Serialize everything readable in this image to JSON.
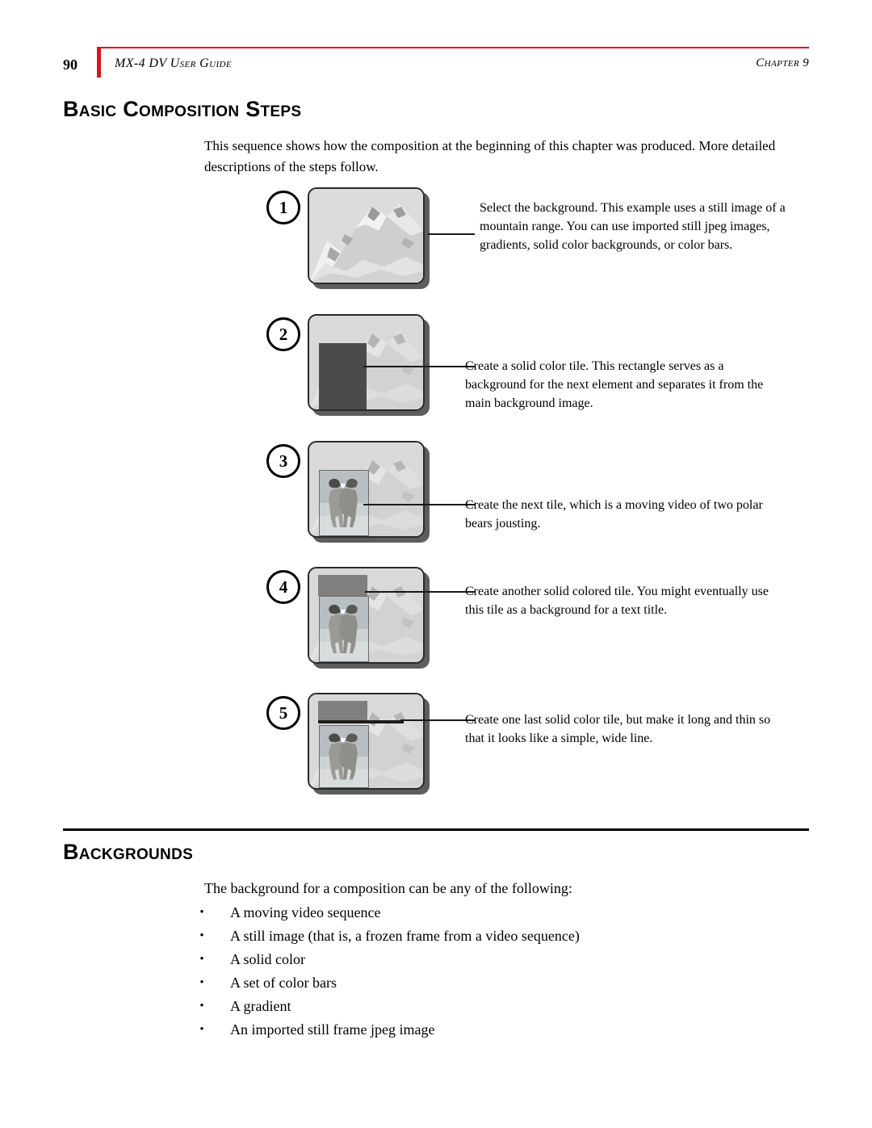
{
  "header": {
    "page_number": "90",
    "title": "MX-4 DV User Guide",
    "chapter": "Chapter 9",
    "rule_color": "#d8151a"
  },
  "sections": {
    "basic_composition": {
      "heading": "Basic Composition Steps",
      "intro": "This sequence shows how the composition at the beginning of this chapter was produced. More detailed descriptions of the steps follow.",
      "steps": [
        {
          "number": "1",
          "caption": "Select the background. This example uses a still image of a mountain range. You can use imported still jpeg images, gradients, solid color backgrounds, or color bars.",
          "thumb_name": "mountain-range-thumbnail"
        },
        {
          "number": "2",
          "caption": "Create a solid color tile. This rectangle serves as a background for the next element and separates it from the main background image.",
          "thumb_name": "solid-color-tile-thumbnail"
        },
        {
          "number": "3",
          "caption": "Create the next tile, which is a moving video of two polar bears jousting.",
          "thumb_name": "polar-bears-video-tile-thumbnail"
        },
        {
          "number": "4",
          "caption": "Create another solid colored tile. You might eventually use this tile as a background for a text title.",
          "thumb_name": "second-solid-tile-thumbnail"
        },
        {
          "number": "5",
          "caption": "Create one last solid color tile, but make it long and thin so that it looks like a simple, wide line.",
          "thumb_name": "thin-line-tile-thumbnail"
        }
      ]
    },
    "backgrounds": {
      "heading": "Backgrounds",
      "intro": "The background for a composition can be any of the following:",
      "bullet_char": "•",
      "bullets": [
        "A moving video sequence",
        "A still image (that is, a frozen frame from a video sequence)",
        "A solid color",
        "A set of color bars",
        "A gradient",
        "An imported still frame jpeg image"
      ]
    }
  }
}
